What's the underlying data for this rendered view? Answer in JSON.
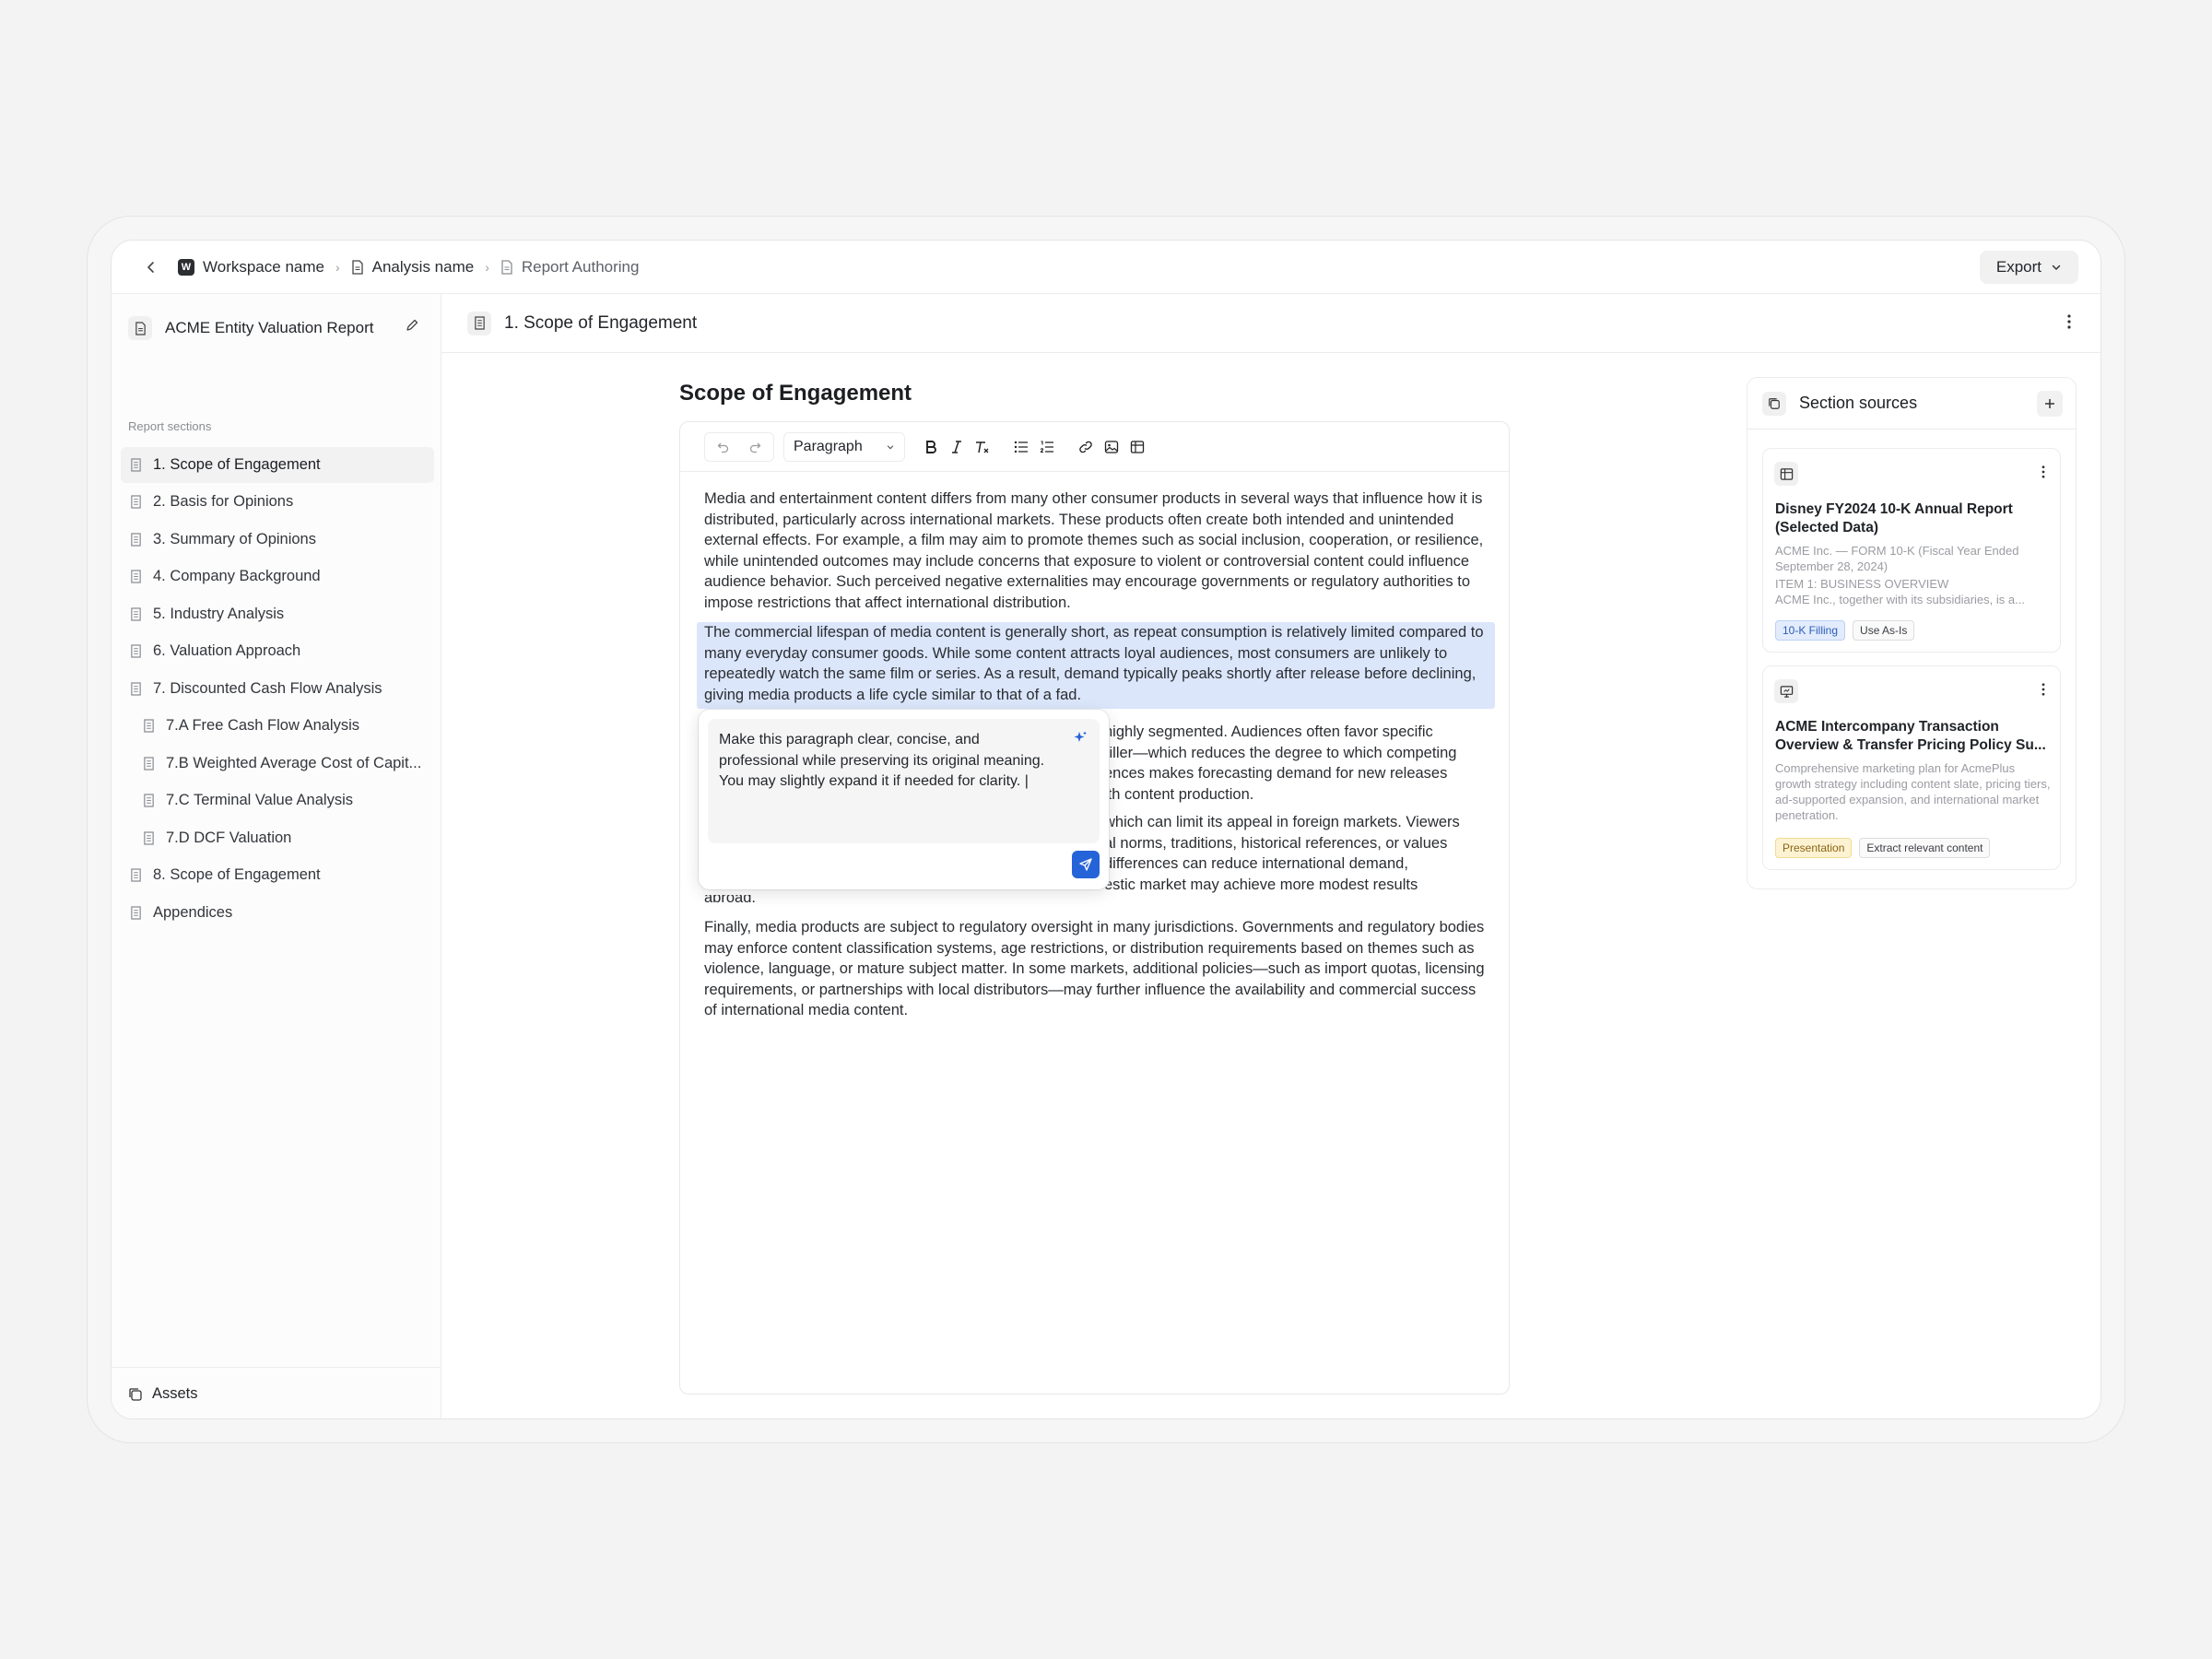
{
  "breadcrumb": {
    "workspace_badge": "W",
    "workspace": "Workspace name",
    "analysis": "Analysis name",
    "page": "Report Authoring"
  },
  "header": {
    "export_label": "Export"
  },
  "sidebar": {
    "report_title": "ACME Entity Valuation Report",
    "sections_label": "Report sections",
    "items": [
      {
        "label": "1. Scope of Engagement"
      },
      {
        "label": "2. Basis for Opinions"
      },
      {
        "label": "3. Summary of Opinions"
      },
      {
        "label": "4. Company Background"
      },
      {
        "label": "5. Industry Analysis"
      },
      {
        "label": "6. Valuation Approach"
      },
      {
        "label": "7. Discounted Cash Flow Analysis"
      },
      {
        "label": "7.A  Free Cash Flow Analysis"
      },
      {
        "label": "7.B  Weighted Average Cost of Capit..."
      },
      {
        "label": "7.C  Terminal Value Analysis"
      },
      {
        "label": "7.D  DCF Valuation"
      },
      {
        "label": "8. Scope of Engagement"
      },
      {
        "label": "Appendices"
      }
    ],
    "footer_label": "Assets"
  },
  "section_header": {
    "title": "1. Scope of Engagement"
  },
  "document": {
    "title": "Scope of Engagement",
    "toolbar": {
      "paragraph_style": "Paragraph"
    },
    "paragraphs": [
      "Media and entertainment content differs from many other consumer products in several ways that influence how it is distributed, particularly across international markets. These products often create both intended and unintended external effects. For example, a film may aim to promote themes such as social inclusion, cooperation, or resilience, while unintended outcomes may include concerns that exposure to violent or controversial content could influence audience behavior. Such perceived negative externalities may encourage governments or regulatory authorities to impose restrictions that affect international distribution.",
      "The commercial lifespan of media content is generally short, as repeat consumption is relatively limited compared to many everyday consumer goods. While some content attracts loyal audiences, most consumers are unlikely to repeatedly watch the same film or series. As a result, demand typically peaks shortly after release before declining, giving media products a life cycle similar to that of a fad.",
      "highly segmented. Audiences often favor specific",
      "riller—which reduces the degree to which competing",
      "ences makes forecasting demand for new releases",
      "ith content production.",
      "which can limit its appeal in foreign markets. Viewers",
      "al norms, traditions, historical references, or values",
      "differences can reduce international demand,",
      "estic market may achieve more modest results",
      "abroad.",
      "Finally, media products are subject to regulatory oversight in many jurisdictions. Governments and regulatory bodies may enforce content classification systems, age restrictions, or distribution requirements based on themes such as violence, language, or mature subject matter. In some markets, additional policies—such as import quotas, licensing requirements, or partnerships with local distributors—may further influence the availability and commercial success of international media content."
    ]
  },
  "ai_prompt": {
    "text": "Make this paragraph clear, concise, and professional while preserving its original meaning. You may slightly expand it if needed for clarity. |"
  },
  "sources": {
    "title": "Section sources",
    "cards": [
      {
        "icon": "table-icon",
        "title": "Disney FY2024 10-K Annual Report (Selected Data)",
        "desc": [
          "ACME Inc. — FORM 10-K (Fiscal Year Ended September 28, 2024)",
          "ITEM 1: BUSINESS OVERVIEW",
          "ACME Inc., together with its subsidiaries, is a..."
        ],
        "tags": [
          "10-K Filling",
          "Use As-Is"
        ]
      },
      {
        "icon": "presentation-icon",
        "title": "ACME Intercompany Transaction Overview & Transfer Pricing Policy Su...",
        "desc": [
          "Comprehensive marketing plan for AcmePlus growth strategy including content slate, pricing tiers, ad-supported expansion, and international market penetration."
        ],
        "tags": [
          "Presentation",
          "Extract relevant content"
        ]
      }
    ]
  },
  "colors": {
    "accent": "#2563d8",
    "highlight": "#dbe6fb"
  }
}
